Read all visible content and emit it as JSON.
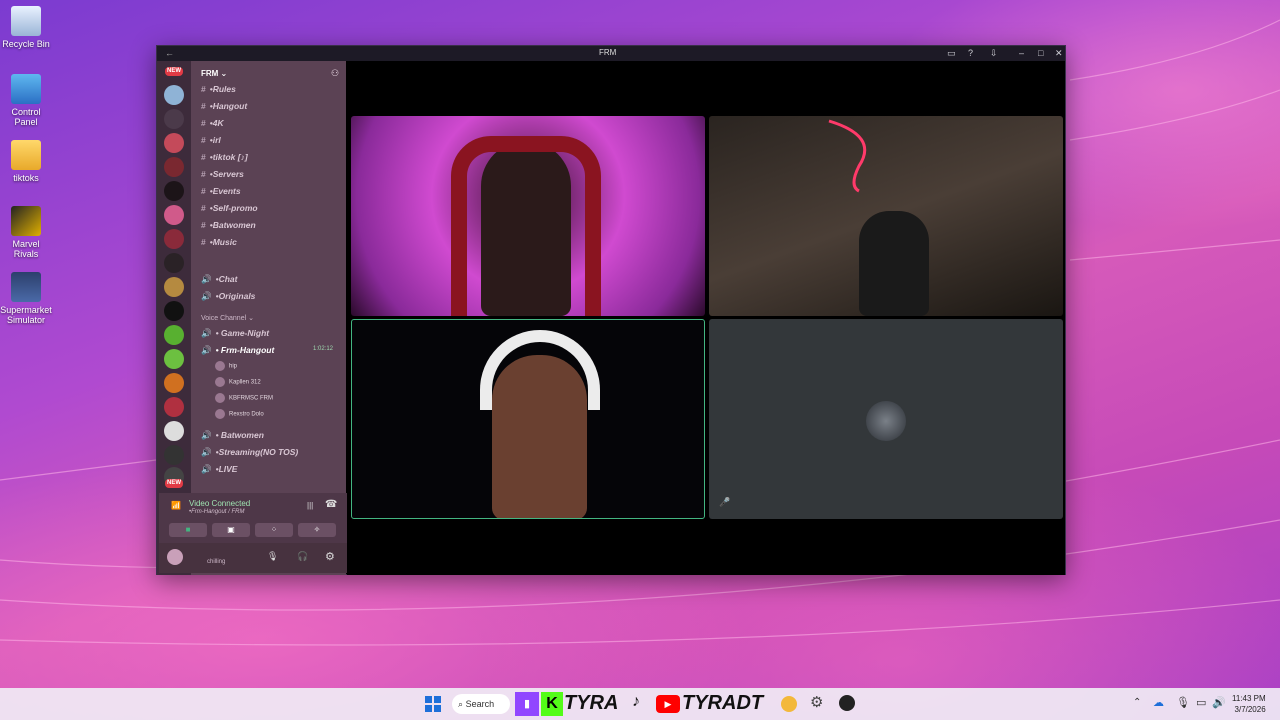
{
  "desktop": {
    "icons": [
      {
        "label": "Recycle Bin"
      },
      {
        "label": "Control Panel"
      },
      {
        "label": "tiktoks"
      },
      {
        "label": "Marvel Rivals"
      },
      {
        "label": "Supermarket Simulator"
      }
    ]
  },
  "window": {
    "title": "FRM",
    "server_name": "FRM",
    "new_badge": "NEW",
    "channels": [
      {
        "name": "•Rules"
      },
      {
        "name": "•Hangout"
      },
      {
        "name": "•4K"
      },
      {
        "name": "•irl"
      },
      {
        "name": "•tiktok [♪]"
      },
      {
        "name": "•Servers"
      },
      {
        "name": "•Events"
      },
      {
        "name": "•Self-promo"
      },
      {
        "name": "•Batwomen"
      },
      {
        "name": "•Music"
      },
      {
        "name": "•Chat"
      },
      {
        "name": "•Originals"
      }
    ],
    "voice_category": "Voice Channel",
    "voice_channels": [
      {
        "name": "• Game-Night"
      },
      {
        "name": "• Frm-Hangout"
      },
      {
        "name": "• Batwomen"
      },
      {
        "name": "•Streaming(NO TOS)"
      },
      {
        "name": "•LIVE"
      }
    ],
    "call_timer": "1:02:12",
    "members": [
      {
        "name": "hip"
      },
      {
        "name": "Kapllen",
        "tag": "312"
      },
      {
        "name": "KBFRMSC",
        "tag": "FRM"
      },
      {
        "name": "Rexstro",
        "tag": "Dolo"
      }
    ],
    "voice_status": "Video Connected",
    "voice_location": "•Frm-Hangout / FRM",
    "user_status": "chilling"
  },
  "taskbar": {
    "search_label": "Search",
    "overlay_left": "TYRA",
    "overlay_right": "TYRADT",
    "time": "11:43 PM",
    "date": "3/7/2026"
  },
  "colors": {
    "accent_green": "#43b581",
    "discord_sidebar": "#5b4254",
    "desktop_pink": "#d65aba"
  }
}
